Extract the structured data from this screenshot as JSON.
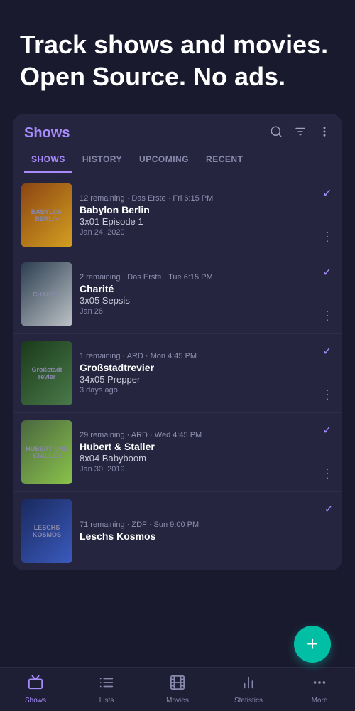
{
  "hero": {
    "title": "Track shows and movies. Open Source. No ads."
  },
  "card": {
    "title": "Shows",
    "tabs": [
      {
        "label": "SHOWS",
        "active": true
      },
      {
        "label": "HISTORY",
        "active": false
      },
      {
        "label": "UPCOMING",
        "active": false
      },
      {
        "label": "RECENT",
        "active": false
      }
    ]
  },
  "shows": [
    {
      "thumb_label": "BABYLON BERLIN",
      "thumb_class": "thumb-babylon",
      "meta": "12 remaining · Das Erste · Fri 6:15 PM",
      "name": "Babylon Berlin",
      "episode": "3x01 Episode 1",
      "date": "Jan 24, 2020"
    },
    {
      "thumb_label": "CHARITÉ",
      "thumb_class": "thumb-charite",
      "meta": "2 remaining · Das Erste · Tue 6:15 PM",
      "name": "Charité",
      "episode": "3x05 Sepsis",
      "date": "Jan 26"
    },
    {
      "thumb_label": "Großstadt revier",
      "thumb_class": "thumb-grossstadt",
      "meta": "1 remaining · ARD · Mon 4:45 PM",
      "name": "Großstadtrevier",
      "episode": "34x05 Prepper",
      "date": "3 days ago"
    },
    {
      "thumb_label": "HUBERT UND STALLER",
      "thumb_class": "thumb-hubert",
      "meta": "29 remaining · ARD · Wed 4:45 PM",
      "name": "Hubert & Staller",
      "episode": "8x04 Babyboom",
      "date": "Jan 30, 2019"
    },
    {
      "thumb_label": "LESCHS KOSMOS",
      "thumb_class": "thumb-leschs",
      "meta": "71 remaining · ZDF · Sun 9:00 PM",
      "name": "Leschs Kosmos",
      "episode": "",
      "date": ""
    }
  ],
  "fab": {
    "label": "+"
  },
  "bottom_nav": [
    {
      "icon": "tv",
      "label": "Shows",
      "active": true
    },
    {
      "icon": "list",
      "label": "Lists",
      "active": false
    },
    {
      "icon": "movie",
      "label": "Movies",
      "active": false
    },
    {
      "icon": "bar_chart",
      "label": "Statistics",
      "active": false
    },
    {
      "icon": "more_horiz",
      "label": "More",
      "active": false
    }
  ]
}
